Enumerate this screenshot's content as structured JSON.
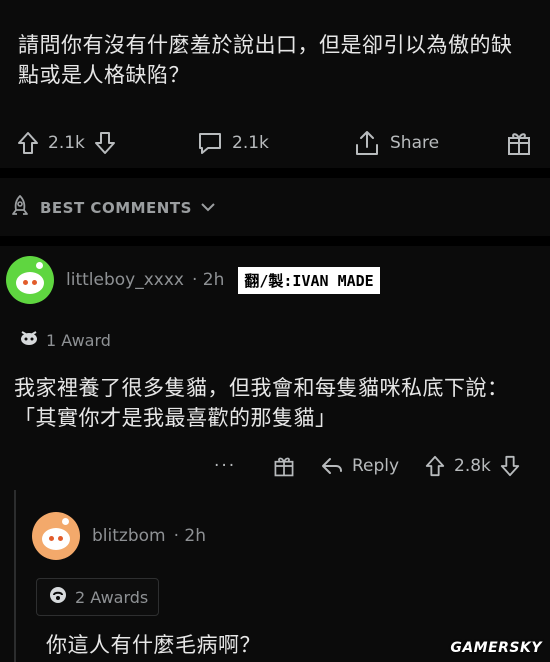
{
  "post": {
    "title": "請問你有沒有什麼羞於說出口，但是卻引以為傲的缺點或是人格缺陷？",
    "upvotes": "2.1k",
    "comments": "2.1k",
    "share_label": "Share"
  },
  "sort": {
    "label": "BEST COMMENTS"
  },
  "comments": [
    {
      "username": "littleboy_xxxx",
      "age": "· 2h",
      "overlay_tag": "翻/製:IVAN MADE",
      "award": "1 Award",
      "body": "我家裡養了很多隻貓，但我會和每隻貓咪私底下說：「其實你才是我最喜歡的那隻貓」",
      "more": "···",
      "reply_label": "Reply",
      "votes": "2.8k"
    },
    {
      "username": "blitzbom",
      "age": "· 2h",
      "award": "2 Awards",
      "body": "你這人有什麼毛病啊？"
    }
  ],
  "watermark": "GAMERSKY",
  "colors": {
    "background": "#0b0b0b",
    "text": "#e6e6e6",
    "muted": "#8e9194",
    "green_avatar": "#5fd640",
    "orange_avatar": "#f3a96b"
  }
}
